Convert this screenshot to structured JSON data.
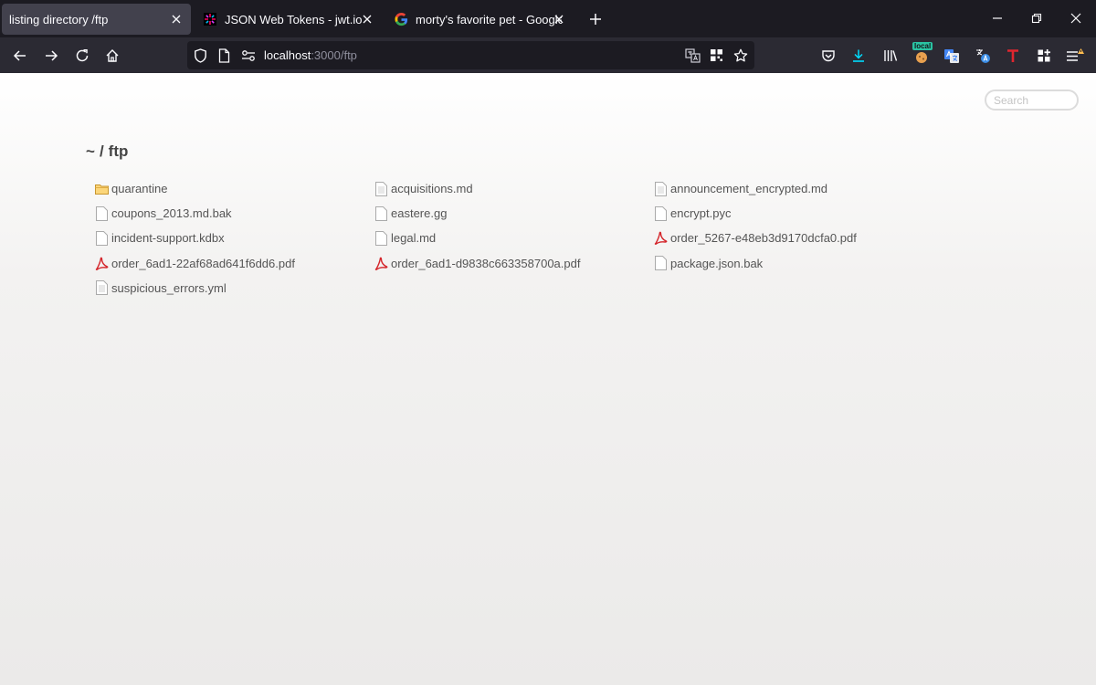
{
  "tabs": [
    {
      "title": "listing directory /ftp",
      "active": true,
      "favicon": "none"
    },
    {
      "title": "JSON Web Tokens - jwt.io",
      "active": false,
      "favicon": "jwt-logo-icon"
    },
    {
      "title": "morty's favorite pet - Google Se",
      "active": false,
      "favicon": "google-logo-icon"
    }
  ],
  "url": {
    "host": "localhost",
    "rest": ":3000/ftp"
  },
  "toolbar": {
    "extension_badge": "local"
  },
  "page": {
    "search_placeholder": "Search",
    "breadcrumb": {
      "home": "~",
      "separator": "/",
      "current": "ftp"
    },
    "files": [
      {
        "name": "quarantine",
        "icon": "folder-icon"
      },
      {
        "name": "acquisitions.md",
        "icon": "text-file-icon"
      },
      {
        "name": "announcement_encrypted.md",
        "icon": "text-file-icon"
      },
      {
        "name": "coupons_2013.md.bak",
        "icon": "blank-file-icon"
      },
      {
        "name": "eastere.gg",
        "icon": "blank-file-icon"
      },
      {
        "name": "encrypt.pyc",
        "icon": "blank-file-icon"
      },
      {
        "name": "incident-support.kdbx",
        "icon": "blank-file-icon"
      },
      {
        "name": "legal.md",
        "icon": "blank-file-icon"
      },
      {
        "name": "order_5267-e48eb3d9170dcfa0.pdf",
        "icon": "pdf-file-icon"
      },
      {
        "name": "order_6ad1-22af68ad641f6dd6.pdf",
        "icon": "pdf-file-icon"
      },
      {
        "name": "order_6ad1-d9838c663358700a.pdf",
        "icon": "pdf-file-icon"
      },
      {
        "name": "package.json.bak",
        "icon": "blank-file-icon"
      },
      {
        "name": "suspicious_errors.yml",
        "icon": "text-file-icon"
      }
    ]
  },
  "colors": {
    "tab_active": "#42414d",
    "chrome_dark": "#1c1b22",
    "toolbar": "#2b2a33",
    "download_accent": "#00ddff",
    "text_file": "#555555"
  }
}
